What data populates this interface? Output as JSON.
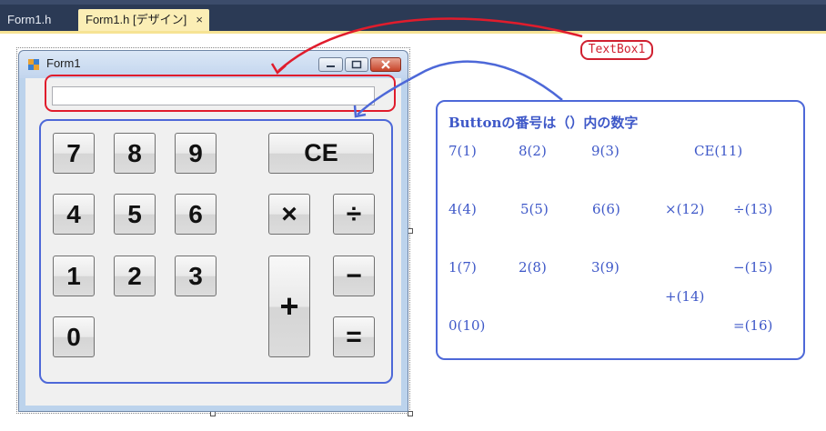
{
  "tabs": [
    {
      "label": "Form1.h"
    },
    {
      "label": "Form1.h [デザイン]",
      "close": "×"
    }
  ],
  "form": {
    "title": "Form1",
    "textbox_value": ""
  },
  "buttons": {
    "b7": "7",
    "b8": "8",
    "b9": "9",
    "bce": "CE",
    "b4": "4",
    "b5": "5",
    "b6": "6",
    "bmul": "×",
    "bdiv": "÷",
    "b1": "1",
    "b2": "2",
    "b3": "3",
    "bminus": "−",
    "bplus": "+",
    "b0": "0",
    "beq": "="
  },
  "annotations": {
    "textbox_label": "TextBox1",
    "note_title": "Buttonの番号は（）内の数字",
    "note_rows": {
      "r1": [
        "7(1)",
        "8(2)",
        "9(3)",
        "CE(11)"
      ],
      "r2": [
        "4(4)",
        "5(5)",
        "6(6)",
        "×(12)",
        "÷(13)"
      ],
      "r3": [
        "1(7)",
        "2(8)",
        "3(9)",
        "−(15)"
      ],
      "r3b": "+(14)",
      "r4": [
        "0(10)",
        "=(16)"
      ]
    }
  },
  "colors": {
    "red_annotation": "#e01c2c",
    "blue_annotation": "#4d68d8",
    "tab_active": "#fbeeb5",
    "tabstrip": "#2b3a55"
  }
}
